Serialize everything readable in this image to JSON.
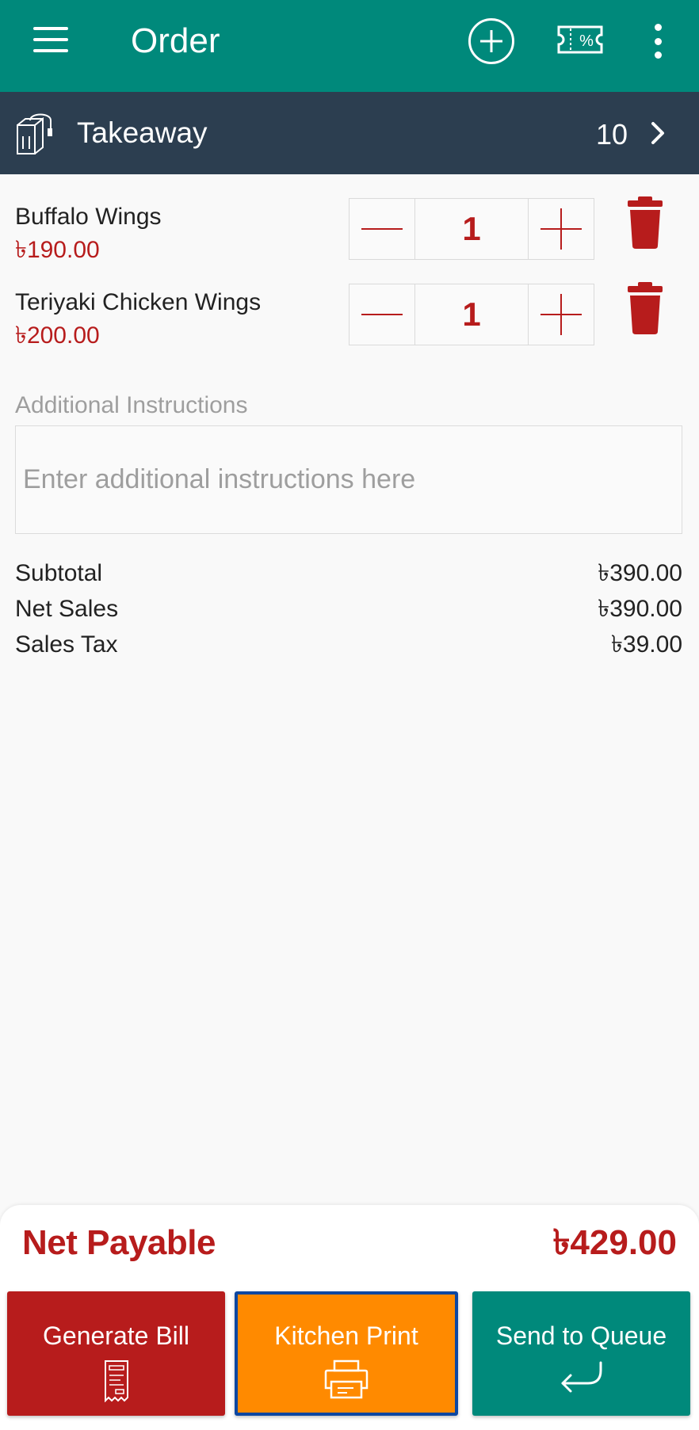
{
  "app_bar": {
    "title": "Order",
    "icons": [
      "menu-icon",
      "add-circle-icon",
      "coupon-discount-icon",
      "more-vertical-icon"
    ]
  },
  "order_type": {
    "label": "Takeaway",
    "count": "10",
    "icons": [
      "takeaway-bag-icon",
      "chevron-right-icon"
    ]
  },
  "items": [
    {
      "name": "Buffalo Wings",
      "price": "৳190.00",
      "quantity": "1"
    },
    {
      "name": "Teriyaki Chicken Wings",
      "price": "৳200.00",
      "quantity": "1"
    }
  ],
  "instructions": {
    "label": "Additional Instructions",
    "placeholder": "Enter additional instructions here",
    "value": ""
  },
  "summary": {
    "subtotal_label": "Subtotal",
    "subtotal_value": "৳390.00",
    "net_sales_label": "Net Sales",
    "net_sales_value": "৳390.00",
    "sales_tax_label": "Sales Tax",
    "sales_tax_value": "৳39.00"
  },
  "net_payable": {
    "label": "Net Payable",
    "value": "৳429.00"
  },
  "actions": {
    "generate_bill": "Generate Bill",
    "kitchen_print": "Kitchen Print",
    "send_to_queue": "Send to Queue"
  },
  "colors": {
    "primary": "#00897b",
    "subbar": "#2c3e50",
    "accent_red": "#b71c1c",
    "kitchen_orange": "#ff8a00",
    "focus_border": "#0d47a1"
  }
}
